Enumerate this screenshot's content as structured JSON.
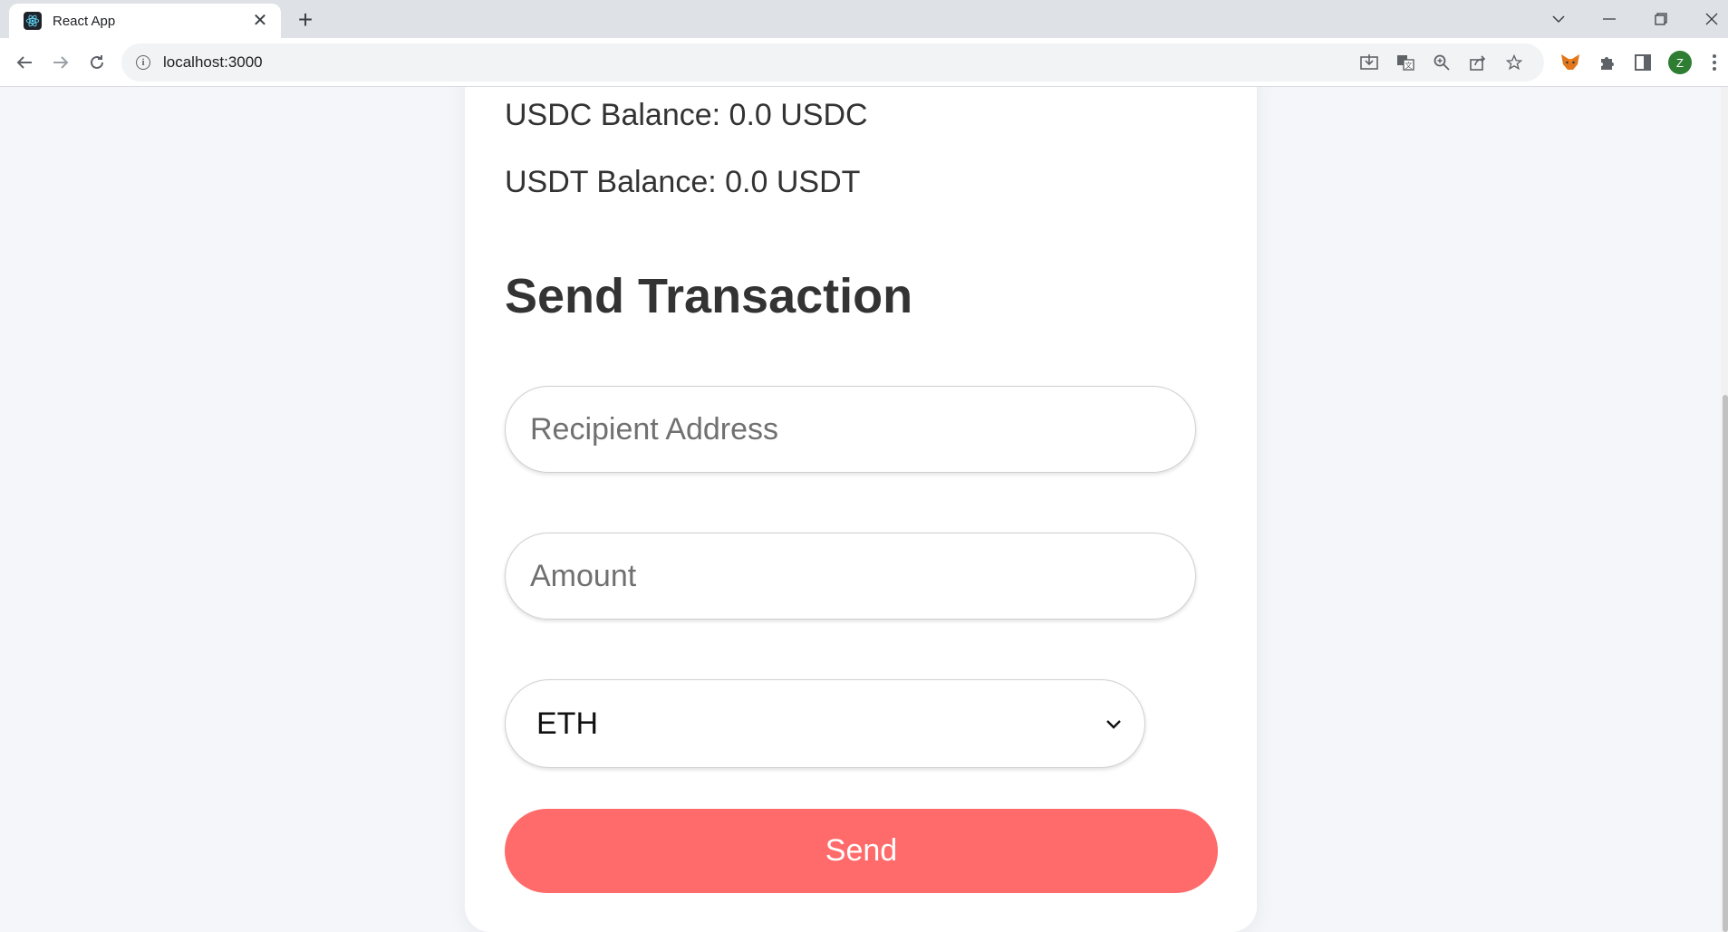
{
  "browser": {
    "tab_title": "React App",
    "url": "localhost:3000",
    "profile_initial": "Z"
  },
  "balances": {
    "usdc": "USDC Balance: 0.0 USDC",
    "usdt": "USDT Balance: 0.0 USDT"
  },
  "form": {
    "heading": "Send Transaction",
    "recipient": {
      "value": "",
      "placeholder": "Recipient Address"
    },
    "amount": {
      "value": "",
      "placeholder": "Amount"
    },
    "token_select": {
      "selected": "ETH"
    },
    "send_label": "Send"
  },
  "colors": {
    "send_button": "#ff6b6b",
    "text": "#333333",
    "page_background": "#f4f6f9"
  }
}
